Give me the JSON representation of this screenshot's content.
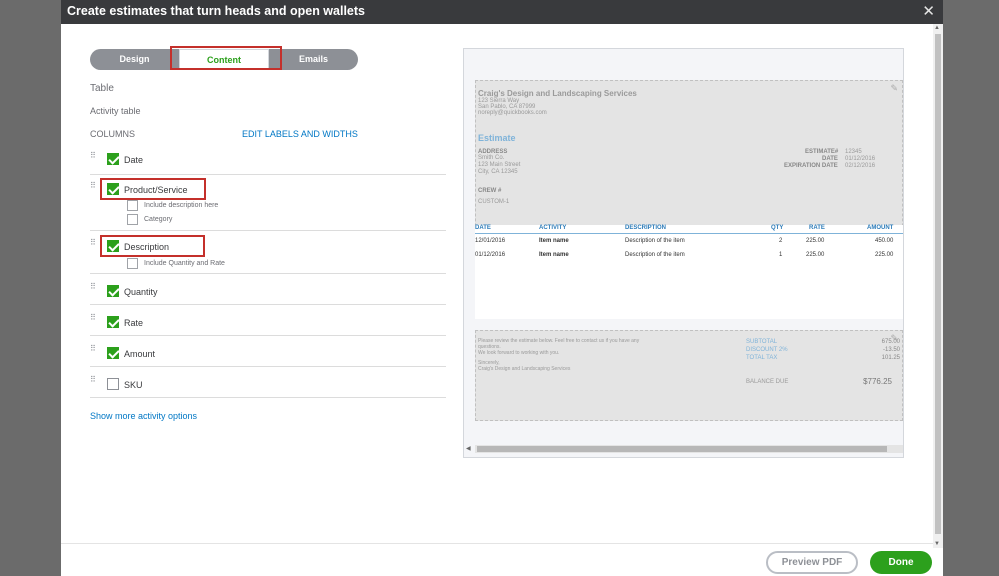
{
  "dialog": {
    "title": "Create estimates that turn heads and open wallets",
    "close_glyph": "✕"
  },
  "tabs": [
    {
      "label": "Design"
    },
    {
      "label": "Content",
      "active": true
    },
    {
      "label": "Emails"
    }
  ],
  "content": {
    "section_title": "Table",
    "subsection": "Activity table",
    "columns_label": "COLUMNS",
    "edit_link": "EDIT LABELS AND WIDTHS",
    "columns": [
      {
        "label": "Date",
        "checked": true
      },
      {
        "label": "Product/Service",
        "checked": true,
        "highlighted": true,
        "options": [
          {
            "label": "Include description here",
            "checked": false
          },
          {
            "label": "Category",
            "checked": false
          }
        ]
      },
      {
        "label": "Description",
        "checked": true,
        "highlighted": true,
        "options": [
          {
            "label": "Include Quantity and Rate",
            "checked": false
          }
        ]
      },
      {
        "label": "Quantity",
        "checked": true
      },
      {
        "label": "Rate",
        "checked": true
      },
      {
        "label": "Amount",
        "checked": true
      },
      {
        "label": "SKU",
        "checked": false
      }
    ],
    "more_link": "Show more activity options"
  },
  "preview": {
    "company_name": "Craig's Design and Landscaping Services",
    "company_address1": "123 Sierra Way",
    "company_address2": "San Pablo, CA 87999",
    "company_email": "noreply@quickbooks.com",
    "doc_title": "Estimate",
    "address_label": "ADDRESS",
    "customer_name": "Smith Co.",
    "customer_address1": "123 Main Street",
    "customer_address2": "City, CA 12345",
    "estimate_no_label": "ESTIMATE#",
    "estimate_no": "12345",
    "date_label": "DATE",
    "date": "01/12/2016",
    "expiration_label": "EXPIRATION DATE",
    "expiration": "02/12/2016",
    "crew_label": "CREW #",
    "crew_value": "CUSTOM-1",
    "table_headers": [
      "DATE",
      "ACTIVITY",
      "DESCRIPTION",
      "QTY",
      "RATE",
      "AMOUNT"
    ],
    "rows": [
      [
        "12/01/2016",
        "Item name",
        "Description of the item",
        "2",
        "225.00",
        "450.00"
      ],
      [
        "01/12/2016",
        "Item name",
        "Description of the item",
        "1",
        "225.00",
        "225.00"
      ]
    ],
    "message_line1": "Please review the estimate below. Feel free to contact us if you have any",
    "message_line2": "questions.",
    "message_line3": "We look forward to working with you.",
    "sincerely": "Sincerely,",
    "signature": "Craig's Design and Landscaping Services",
    "subtotal_label": "SUBTOTAL",
    "subtotal": "675.00",
    "discount_label": "DISCOUNT 2%",
    "discount": "-13.50",
    "tax_label": "TOTAL TAX",
    "tax": "101.25",
    "balance_label": "BALANCE DUE",
    "balance": "$776.25"
  },
  "footer": {
    "preview_pdf": "Preview PDF",
    "done": "Done"
  },
  "colors": {
    "accent": "#2ca01c",
    "link": "#0077c5",
    "titlebar": "#393a3d",
    "highlight": "#c4302b"
  }
}
